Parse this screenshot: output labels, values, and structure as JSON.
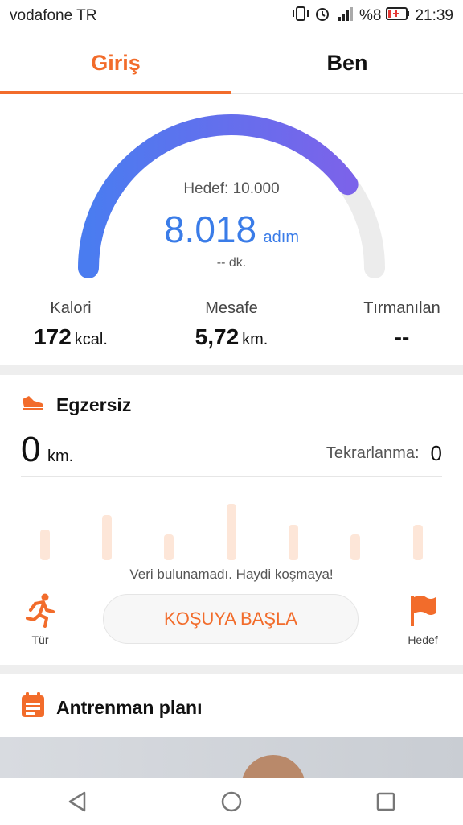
{
  "status_bar": {
    "carrier": "vodafone TR",
    "battery_text": "%8",
    "time": "21:39"
  },
  "tabs": [
    {
      "label": "Giriş",
      "active": true
    },
    {
      "label": "Ben",
      "active": false
    }
  ],
  "steps": {
    "goal_label": "Hedef: 10.000",
    "count": "8.018",
    "unit": "adım",
    "duration": "-- dk.",
    "progress": 0.8018
  },
  "stats": {
    "calories": {
      "label": "Kalori",
      "value": "172",
      "unit": "kcal."
    },
    "distance": {
      "label": "Mesafe",
      "value": "5,72",
      "unit": "km."
    },
    "climb": {
      "label": "Tırmanılan",
      "value": "--"
    }
  },
  "exercise": {
    "title": "Egzersiz",
    "distance_value": "0",
    "distance_unit": "km.",
    "repeat_label": "Tekrarlanma:",
    "repeat_value": "0",
    "no_data": "Veri bulunamadı. Haydi koşmaya!",
    "type_label": "Tür",
    "start_button": "KOŞUYA BAŞLA",
    "goal_label": "Hedef"
  },
  "training_plan": {
    "title": "Antrenman planı"
  },
  "colors": {
    "accent": "#f26c2b",
    "gauge_start": "#4a7cf0",
    "gauge_end": "#7b63ea",
    "steps_blue": "#3a7ce8"
  }
}
